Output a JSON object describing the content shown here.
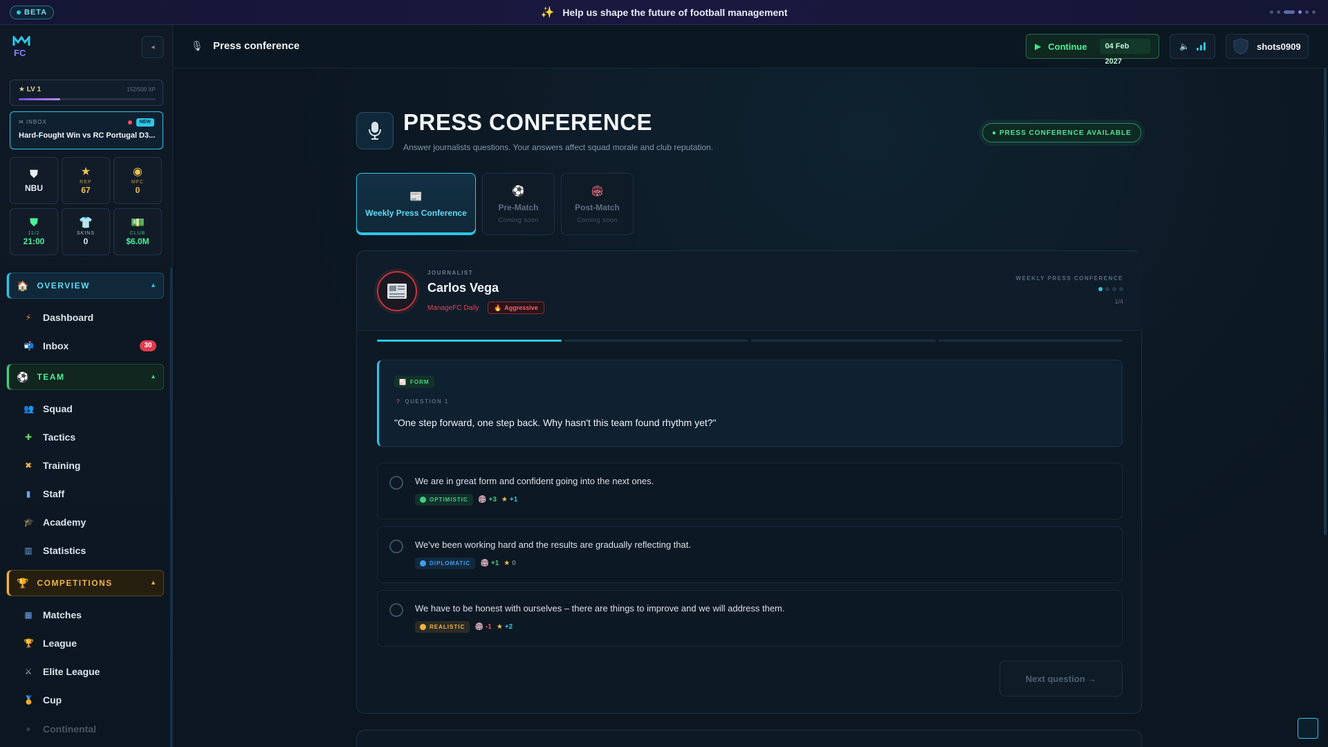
{
  "banner": {
    "beta_label": "BETA",
    "message": "Help us shape the future of football management"
  },
  "sidebar": {
    "level": {
      "label": "LV 1",
      "xp": "152/500 XP",
      "progress": 0.304
    },
    "inbox_card": {
      "label": "INBOX",
      "badge": "NEW",
      "title": "Hard-Fought Win vs RC Portugal D3..."
    },
    "tiles": [
      {
        "label": "",
        "value": "NBU",
        "icon": "club-crest-icon",
        "color": "#e8eef4"
      },
      {
        "label": "REP",
        "value": "67",
        "icon": "star-icon",
        "color": "#f2c44b"
      },
      {
        "label": "MFC",
        "value": "0",
        "icon": "coin-icon",
        "color": "#f2c44b"
      },
      {
        "label": "11/2",
        "value": "21:00",
        "icon": "shield-icon",
        "color": "#4cf09a"
      },
      {
        "label": "SKINS",
        "value": "0",
        "icon": "shirt-icon",
        "color": "#e8eef4"
      },
      {
        "label": "CLUB",
        "value": "$6.0M",
        "icon": "cash-icon",
        "color": "#4cf09a"
      }
    ],
    "groups": {
      "overview": "OVERVIEW",
      "team": "TEAM",
      "competitions": "COMPETITIONS"
    },
    "items": {
      "dashboard": "Dashboard",
      "inbox": "Inbox",
      "inbox_count": "30",
      "squad": "Squad",
      "tactics": "Tactics",
      "training": "Training",
      "staff": "Staff",
      "academy": "Academy",
      "statistics": "Statistics",
      "matches": "Matches",
      "league": "League",
      "elite_league": "Elite League",
      "cup": "Cup",
      "continental": "Continental"
    }
  },
  "topbar": {
    "title": "Press conference",
    "continue_label": "Continue",
    "date": "04 Feb 2027",
    "username": "shots0909"
  },
  "header": {
    "title": "PRESS CONFERENCE",
    "subtitle": "Answer journalists questions. Your answers affect squad morale and club reputation.",
    "status": "● PRESS CONFERENCE AVAILABLE"
  },
  "tabs": [
    {
      "label": "Weekly Press Conference",
      "sub": ""
    },
    {
      "label": "Pre-Match",
      "sub": "Coming soon"
    },
    {
      "label": "Post-Match",
      "sub": "Coming soon"
    }
  ],
  "journalist": {
    "label": "JOURNALIST",
    "name": "Carlos Vega",
    "outlet": "ManageFC Daily",
    "tag": "Aggressive",
    "session_label": "WEEKLY PRESS CONFERENCE",
    "count": "1/4",
    "current": 1,
    "total": 4
  },
  "question": {
    "topic": "FORM",
    "number": "QUESTION 1",
    "text": "\"One step forward, one step back. Why hasn't this team found rhythm yet?\""
  },
  "answers": [
    {
      "text": "We are in great form and confident going into the next ones.",
      "tone": "OPTIMISTIC",
      "tone_color": "#3fd07e",
      "morale": "+3",
      "morale_color": "#3fd07e",
      "rep": "+1",
      "rep_color": "#2ec7e8"
    },
    {
      "text": "We've been working hard and the results are gradually reflecting that.",
      "tone": "DIPLOMATIC",
      "tone_color": "#3ea0f0",
      "morale": "+1",
      "morale_color": "#3fd07e",
      "rep": "0",
      "rep_color": "#6d7e92"
    },
    {
      "text": "We have to be honest with ourselves – there are things to improve and we will address them.",
      "tone": "REALISTIC",
      "tone_color": "#f2b544",
      "morale": "-1",
      "morale_color": "#ef4f5c",
      "rep": "+2",
      "rep_color": "#2ec7e8"
    }
  ],
  "next_button": "Next question →"
}
